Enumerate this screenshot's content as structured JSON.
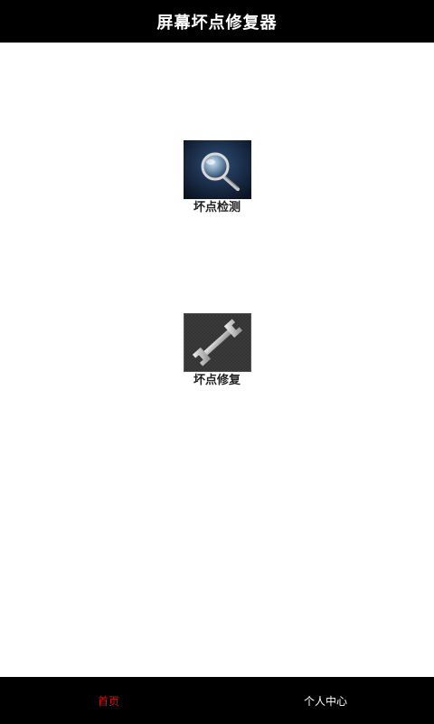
{
  "app": {
    "title": "屏幕坏点修复器"
  },
  "features": [
    {
      "label": "坏点检测",
      "icon": "magnifier-icon"
    },
    {
      "label": "坏点修复",
      "icon": "wrench-icon"
    }
  ],
  "bottom_nav": {
    "items": [
      {
        "label": "首页",
        "active": true
      },
      {
        "label": "个人中心",
        "active": false
      }
    ]
  },
  "colors": {
    "bar_background": "#000000",
    "active_nav": "#cc1111",
    "inactive_nav": "#ffffff",
    "detect_tile": "#1b2b44",
    "repair_tile": "#3a3a3a"
  }
}
